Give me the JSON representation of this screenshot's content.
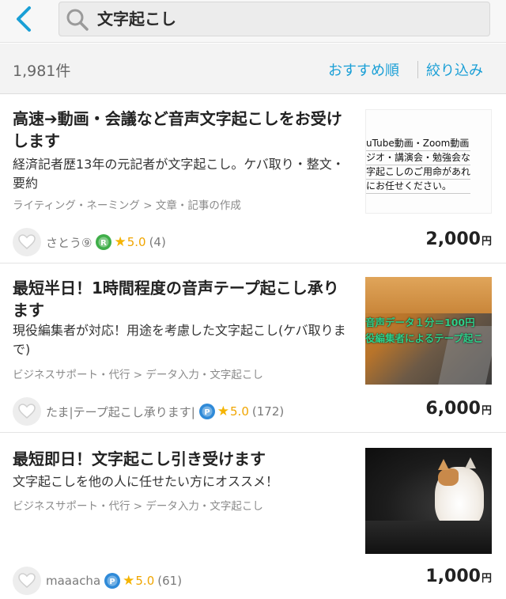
{
  "header": {
    "search_query": "文字起こし"
  },
  "results": {
    "count": "1,981件",
    "sort_label": "おすすめ順",
    "filter_label": "絞り込み"
  },
  "listings": [
    {
      "title": "高速➔動画・会議など音声文字起こしをお受けします",
      "description": "経済記者歴13年の元記者が文字起こし。ケバ取り・整文・要約",
      "category": "ライティング・ネーミング > 文章・記事の作成",
      "seller": "さとう⑨",
      "rating": "5.0",
      "reviews": "(4)",
      "price": "2,000",
      "currency": "円",
      "thumb_lines": [
        "uTube動画・Zoom動画",
        "ジオ・講演会・勉強会な",
        "字起こしのご用命があれ",
        "にお任せください。"
      ]
    },
    {
      "title": "最短半日！1時間程度の音声テープ起こし承ります",
      "description": "現役編集者が対応！用途を考慮した文字起こし(ケバ取りまで)",
      "category": "ビジネスサポート・代行 > データ入力・文字起こし",
      "seller": "たま|テープ起こし承ります|",
      "rating": "5.0",
      "reviews": "(172)",
      "price": "6,000",
      "currency": "円",
      "thumb_lines": [
        "音声データ１分＝100円",
        "役編集者によるテープ起こ"
      ]
    },
    {
      "title": "最短即日！文字起こし引き受けます",
      "description": "文字起こしを他の人に任せたい方にオススメ！",
      "category": "ビジネスサポート・代行 > データ入力・文字起こし",
      "seller": "maaacha",
      "rating": "5.0",
      "reviews": "(61)",
      "price": "1,000",
      "currency": "円",
      "thumb_lines": []
    }
  ],
  "colors": {
    "accent": "#1a9fd6",
    "star": "#f5b400",
    "rank_green": "#3fae49",
    "rank_blue": "#2f8ad8"
  }
}
